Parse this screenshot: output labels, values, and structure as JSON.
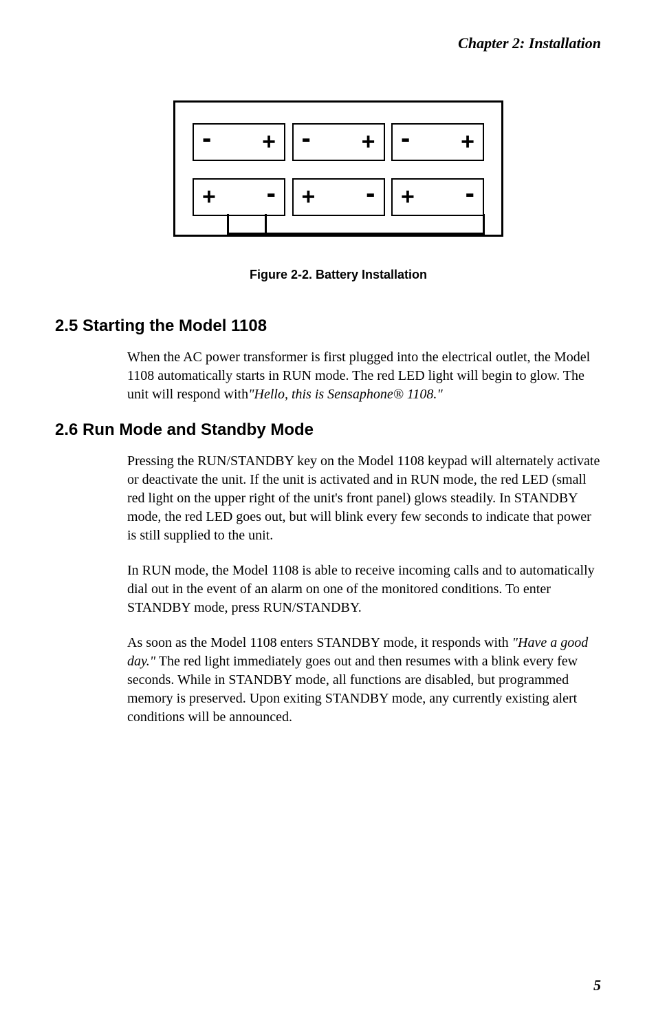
{
  "header": {
    "chapter": "Chapter  2:   Installation"
  },
  "chart_data": {
    "type": "diagram",
    "description": "Battery installation diagram showing 6 batteries in 2 rows with polarity markings",
    "rows": [
      {
        "batteries": [
          {
            "left": "-",
            "right": "+"
          },
          {
            "left": "-",
            "right": "+"
          },
          {
            "left": "-",
            "right": "+"
          }
        ]
      },
      {
        "batteries": [
          {
            "left": "+",
            "right": "-"
          },
          {
            "left": "+",
            "right": "-"
          },
          {
            "left": "+",
            "right": "-"
          }
        ]
      }
    ]
  },
  "figure": {
    "caption": "Figure 2-2.  Battery Installation"
  },
  "sections": [
    {
      "heading": "2.5  Starting the Model 1108",
      "paragraphs": [
        {
          "text_parts": [
            {
              "text": "When the AC power transformer is first plugged into the electrical outlet,  the Model 1108 automatically starts in RUN mode. The red LED light will begin to glow. The unit will respond with",
              "italic": false
            },
            {
              "text": "\"Hello, this is Sensaphone® 1108.\"",
              "italic": true
            }
          ]
        }
      ]
    },
    {
      "heading": "2.6  Run Mode and Standby Mode",
      "paragraphs": [
        {
          "text_parts": [
            {
              "text": "Pressing the RUN/STANDBY key on the Model 1108 keypad will alternately activate or deactivate the unit. If the unit is activated and in RUN mode, the red LED (small red light on the upper right of the unit's front panel) glows steadily. In STANDBY mode, the red LED goes out, but will blink every few seconds to indicate that power is still supplied to the unit.",
              "italic": false
            }
          ]
        },
        {
          "text_parts": [
            {
              "text": "In RUN mode, the Model 1108 is able to receive incoming calls and to automatically dial out in the event of an alarm on one of the monitored conditions. To enter STANDBY mode, press RUN/STANDBY.",
              "italic": false
            }
          ]
        },
        {
          "text_parts": [
            {
              "text": "As soon as the Model 1108 enters STANDBY mode, it responds with ",
              "italic": false
            },
            {
              "text": "\"Have a good day.\"",
              "italic": true
            },
            {
              "text": " The red light immediately goes out and then resumes with a blink every few seconds. While in STANDBY mode, all functions are disabled, but programmed memory is preserved. Upon exiting STANDBY mode, any currently existing alert conditions will be announced.",
              "italic": false
            }
          ]
        }
      ]
    }
  ],
  "page_number": "5"
}
